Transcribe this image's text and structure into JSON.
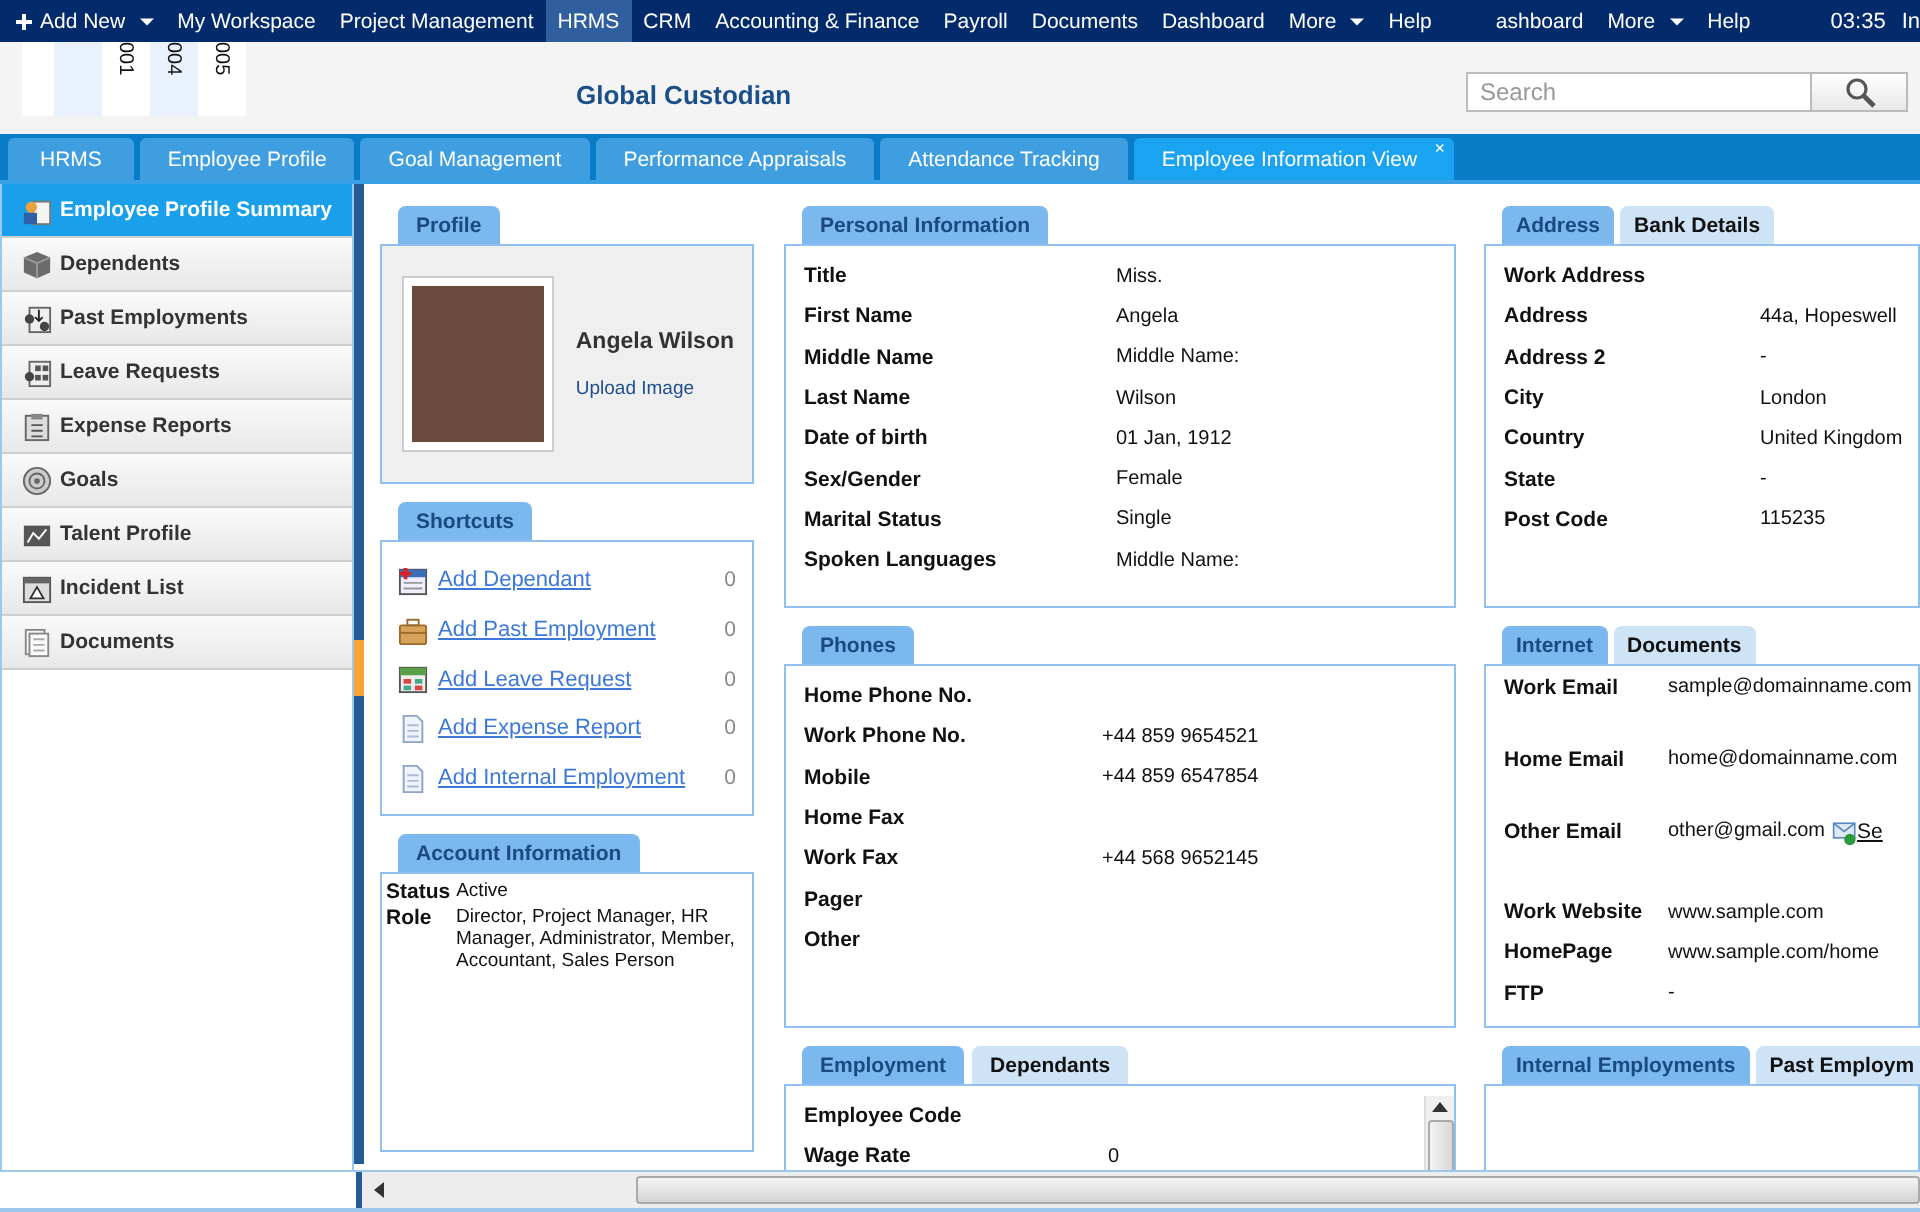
{
  "nav": {
    "items": [
      {
        "label": "Add New",
        "plus": true,
        "dropdown": true,
        "selected": false
      },
      {
        "label": "My Workspace",
        "plus": false,
        "dropdown": false,
        "selected": false
      },
      {
        "label": "Project Management",
        "plus": false,
        "dropdown": false,
        "selected": false
      },
      {
        "label": "HRMS",
        "plus": false,
        "dropdown": false,
        "selected": true
      },
      {
        "label": "CRM",
        "plus": false,
        "dropdown": false,
        "selected": false
      },
      {
        "label": "Accounting & Finance",
        "plus": false,
        "dropdown": false,
        "selected": false
      },
      {
        "label": "Payroll",
        "plus": false,
        "dropdown": false,
        "selected": false
      },
      {
        "label": "Documents",
        "plus": false,
        "dropdown": false,
        "selected": false
      },
      {
        "label": "Dashboard",
        "plus": false,
        "dropdown": false,
        "selected": false
      },
      {
        "label": "More",
        "plus": false,
        "dropdown": true,
        "selected": false
      },
      {
        "label": "Help",
        "plus": false,
        "dropdown": false,
        "selected": false
      },
      {
        "label": "ashboard",
        "plus": false,
        "dropdown": false,
        "selected": false
      },
      {
        "label": "More",
        "plus": false,
        "dropdown": true,
        "selected": false
      },
      {
        "label": "Help",
        "plus": false,
        "dropdown": false,
        "selected": false
      }
    ],
    "time": "03:35",
    "user": "In"
  },
  "header": {
    "columns": [
      "001",
      "004",
      "005"
    ],
    "title": "Global Custodian",
    "search": {
      "placeholder": "Search"
    }
  },
  "tabs": [
    {
      "label": "HRMS",
      "selected": false
    },
    {
      "label": "Employee Profile",
      "selected": false
    },
    {
      "label": "Goal Management",
      "selected": false
    },
    {
      "label": "Performance Appraisals",
      "selected": false
    },
    {
      "label": "Attendance Tracking",
      "selected": false
    },
    {
      "label": "Employee Information View",
      "selected": true,
      "close": "×"
    }
  ],
  "sidebar": {
    "items": [
      {
        "label": "Employee Profile Summary",
        "selected": true
      },
      {
        "label": "Dependents",
        "selected": false
      },
      {
        "label": "Past Employments",
        "selected": false
      },
      {
        "label": "Leave Requests",
        "selected": false
      },
      {
        "label": "Expense Reports",
        "selected": false
      },
      {
        "label": "Goals",
        "selected": false
      },
      {
        "label": "Talent Profile",
        "selected": false
      },
      {
        "label": "Incident List",
        "selected": false
      },
      {
        "label": "Documents",
        "selected": false
      }
    ]
  },
  "profile": {
    "tab": "Profile",
    "name": "Angela Wilson",
    "upload": "Upload Image"
  },
  "shortcuts": {
    "tab": "Shortcuts",
    "items": [
      {
        "label": "Add Dependant",
        "count": "0"
      },
      {
        "label": "Add Past Employment",
        "count": "0"
      },
      {
        "label": "Add Leave Request",
        "count": "0"
      },
      {
        "label": "Add Expense Report",
        "count": "0"
      },
      {
        "label": "Add Internal Employment",
        "count": "0"
      }
    ]
  },
  "account": {
    "tab": "Account Information",
    "fields": [
      {
        "label": "Status",
        "value": "Active"
      },
      {
        "label": "Role",
        "value": "Director, Project Manager, HR Manager, Administrator, Member, Accountant, Sales Person"
      }
    ]
  },
  "personal": {
    "tabs": [
      {
        "label": "Personal Information",
        "selected": true
      }
    ],
    "rows": [
      {
        "label": "Title",
        "value": "Miss."
      },
      {
        "label": "First Name",
        "value": "Angela"
      },
      {
        "label": "Middle Name",
        "value": "Middle Name:"
      },
      {
        "label": "Last Name",
        "value": "Wilson"
      },
      {
        "label": "Date of birth",
        "value": "01 Jan, 1912"
      },
      {
        "label": "Sex/Gender",
        "value": "Female"
      },
      {
        "label": "Marital Status",
        "value": "Single"
      },
      {
        "label": "Spoken Languages",
        "value": "Middle Name:"
      }
    ]
  },
  "address": {
    "tabs": [
      {
        "label": "Address",
        "selected": true
      },
      {
        "label": "Bank Details",
        "selected": false
      }
    ],
    "rows": [
      {
        "label": "Work Address",
        "value": ""
      },
      {
        "label": "Address",
        "value": "44a, Hopeswell"
      },
      {
        "label": "Address 2",
        "value": "-"
      },
      {
        "label": "City",
        "value": "London"
      },
      {
        "label": "Country",
        "value": "United Kingdom"
      },
      {
        "label": "State",
        "value": "-"
      },
      {
        "label": "Post Code",
        "value": "115235"
      }
    ]
  },
  "phones": {
    "tabs": [
      {
        "label": "Phones",
        "selected": true
      }
    ],
    "rows": [
      {
        "label": "Home Phone No.",
        "value": ""
      },
      {
        "label": "Work Phone No.",
        "value": "+44 859 9654521"
      },
      {
        "label": "Mobile",
        "value": "+44 859 6547854"
      },
      {
        "label": "Home Fax",
        "value": ""
      },
      {
        "label": "Work Fax",
        "value": "+44 568 9652145"
      },
      {
        "label": "Pager",
        "value": ""
      },
      {
        "label": "Other",
        "value": ""
      }
    ]
  },
  "internet": {
    "tabs": [
      {
        "label": "Internet",
        "selected": true
      },
      {
        "label": "Documents",
        "selected": false
      }
    ],
    "rows": [
      {
        "kind": "email",
        "label": "Work Email",
        "value": "sample@domainname.com"
      },
      {
        "kind": "email",
        "label": "Home Email",
        "value": "home@domainname.com"
      },
      {
        "kind": "email",
        "label": "Other Email",
        "value": "other@gmail.com",
        "action": "Se"
      },
      {
        "kind": "link",
        "label": "Work Website",
        "value": "www.sample.com"
      },
      {
        "kind": "link",
        "label": "HomePage",
        "value": "www.sample.com/home"
      },
      {
        "kind": "link",
        "label": "FTP",
        "value": "-"
      }
    ]
  },
  "employment": {
    "tabs": [
      {
        "label": "Employment",
        "selected": true
      },
      {
        "label": "Dependants",
        "selected": false
      }
    ],
    "rows": [
      {
        "label": "Employee Code",
        "value": ""
      },
      {
        "label": "Wage Rate",
        "value": "0"
      }
    ]
  },
  "internal": {
    "tabs": [
      {
        "label": "Internal Employments",
        "selected": true
      },
      {
        "label": "Past Employm",
        "selected": false
      }
    ]
  }
}
